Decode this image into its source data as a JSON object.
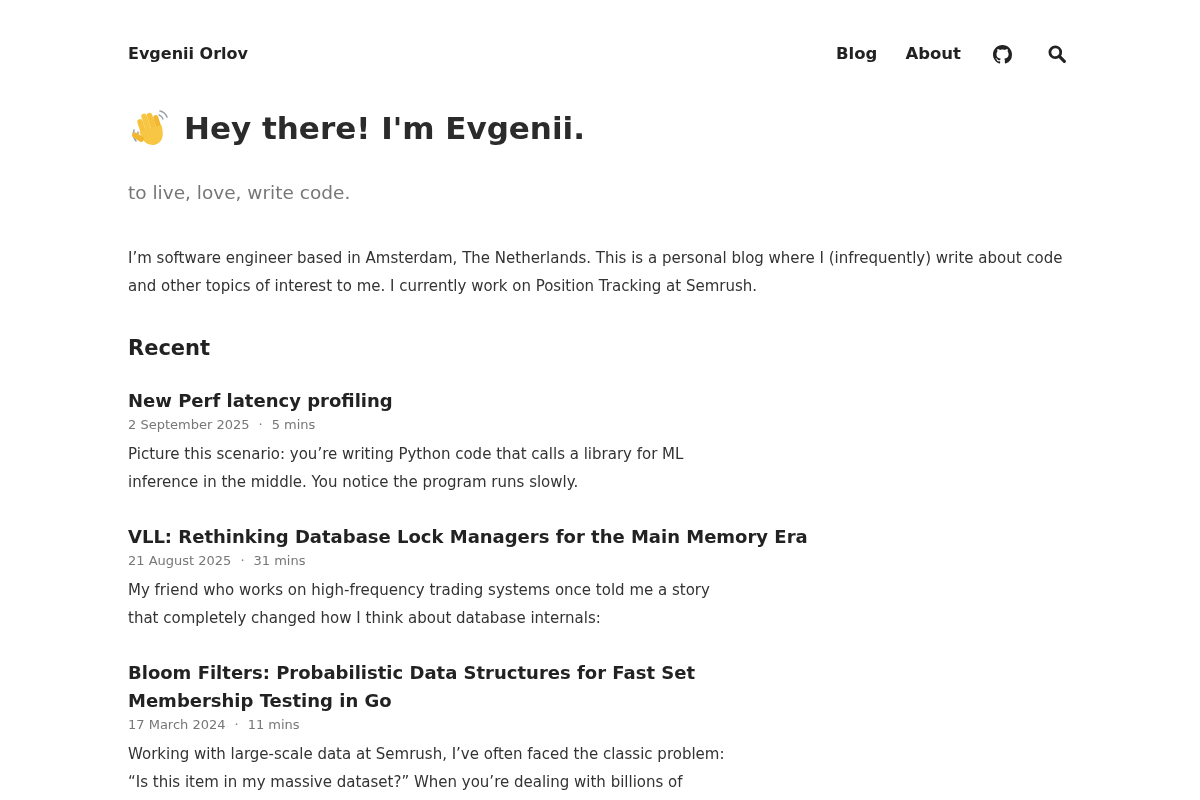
{
  "header": {
    "site_title": "Evgenii Orlov",
    "nav": [
      {
        "label": "Blog"
      },
      {
        "label": "About"
      }
    ]
  },
  "hero": {
    "heading": "Hey there! I'm Evgenii.",
    "tagline": "to live, love, write code.",
    "intro": "I’m software engineer based in Amsterdam, The Netherlands. This is a personal blog where I (infrequently) write about code and other topics of interest to me. I currently work on Position Tracking at Semrush."
  },
  "recent": {
    "heading": "Recent",
    "posts": [
      {
        "title": "New Perf latency profiling",
        "date": "2 September 2025",
        "separator": "·",
        "read_time": "5 mins",
        "summary": "Picture this scenario: you’re writing Python code that calls a library for ML inference in the middle. You notice the program runs slowly."
      },
      {
        "title": "VLL: Rethinking Database Lock Managers for the Main Memory Era",
        "date": "21 August 2025",
        "separator": "·",
        "read_time": "31 mins",
        "summary": "My friend who works on high-frequency trading systems once told me a story that completely changed how I think about database internals:"
      },
      {
        "title": "Bloom Filters: Probabilistic Data Structures for Fast Set Membership Testing in Go",
        "date": "17 March 2024",
        "separator": "·",
        "read_time": "11 mins",
        "summary": "Working with large-scale data at Semrush, I’ve often faced the classic problem: “Is this item in my massive dataset?” When you’re dealing with billions of"
      }
    ]
  }
}
